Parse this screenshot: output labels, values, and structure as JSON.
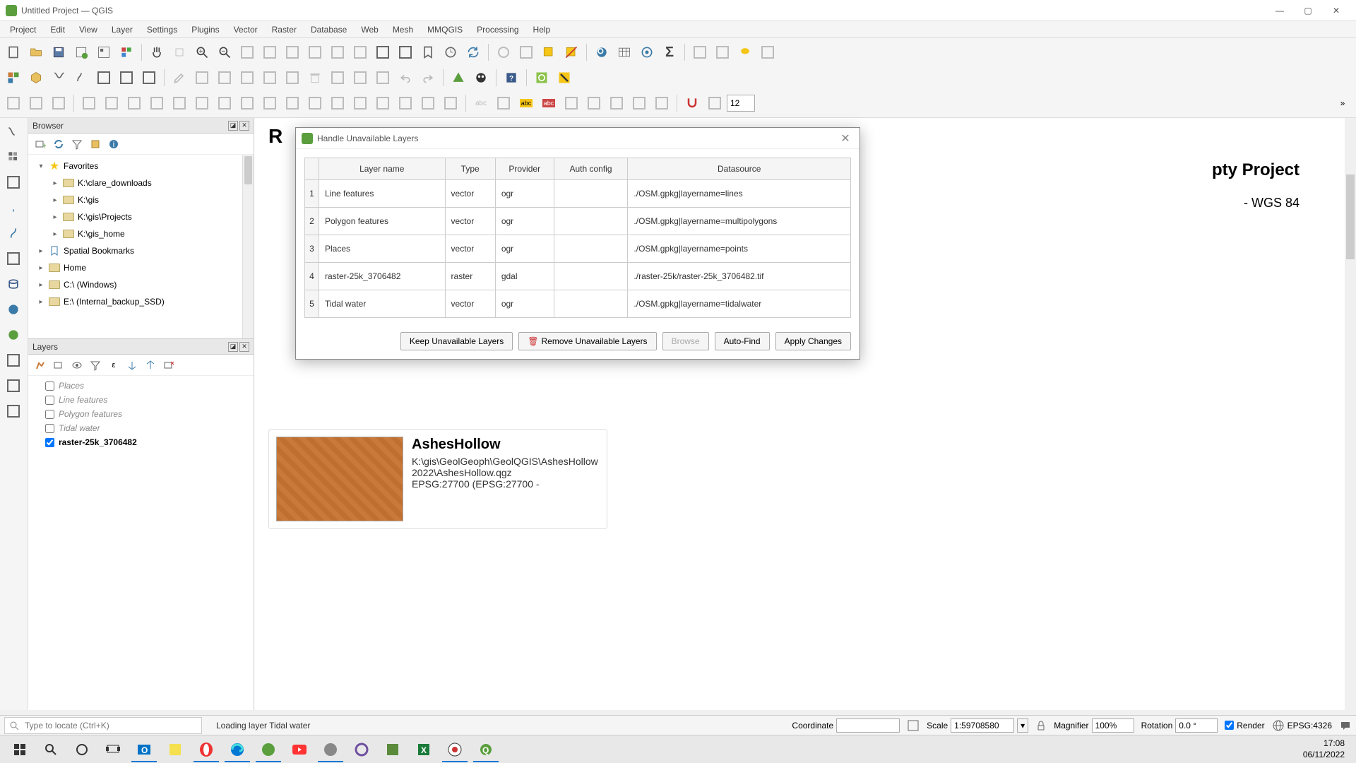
{
  "window": {
    "title": "Untitled Project — QGIS"
  },
  "menu": [
    "Project",
    "Edit",
    "View",
    "Layer",
    "Settings",
    "Plugins",
    "Vector",
    "Raster",
    "Database",
    "Web",
    "Mesh",
    "MMQGIS",
    "Processing",
    "Help"
  ],
  "browser": {
    "title": "Browser",
    "items": [
      {
        "label": "Favorites",
        "icon": "star",
        "depth": 0,
        "expanded": true
      },
      {
        "label": "K:\\clare_downloads",
        "icon": "folder",
        "depth": 1
      },
      {
        "label": "K:\\gis",
        "icon": "folder",
        "depth": 1
      },
      {
        "label": "K:\\gis\\Projects",
        "icon": "folder",
        "depth": 1
      },
      {
        "label": "K:\\gis_home",
        "icon": "folder",
        "depth": 1
      },
      {
        "label": "Spatial Bookmarks",
        "icon": "bookmark",
        "depth": 0
      },
      {
        "label": "Home",
        "icon": "folder",
        "depth": 0
      },
      {
        "label": "C:\\ (Windows)",
        "icon": "folder",
        "depth": 0
      },
      {
        "label": "E:\\ (Internal_backup_SSD)",
        "icon": "folder",
        "depth": 0
      }
    ]
  },
  "layers": {
    "title": "Layers",
    "items": [
      {
        "name": "Places",
        "checked": false,
        "broken": true
      },
      {
        "name": "Line features",
        "checked": false,
        "broken": true
      },
      {
        "name": "Polygon features",
        "checked": false,
        "broken": true
      },
      {
        "name": "Tidal water",
        "checked": false,
        "broken": true
      },
      {
        "name": "raster-25k_3706482",
        "checked": true,
        "broken": false
      }
    ]
  },
  "canvas": {
    "recent_heading": "R",
    "news_heading": "pty Project",
    "news_crs": "- WGS 84",
    "project": {
      "title": "AshesHollow",
      "path": "K:\\gis\\GeolGeoph\\GeolQGIS\\AshesHollow2022\\AshesHollow.qgz",
      "crs": "EPSG:27700 (EPSG:27700 -"
    }
  },
  "dialog": {
    "title": "Handle Unavailable Layers",
    "columns": [
      "Layer name",
      "Type",
      "Provider",
      "Auth config",
      "Datasource"
    ],
    "rows": [
      {
        "n": "1",
        "name": "Line features",
        "type": "vector",
        "provider": "ogr",
        "auth": "",
        "ds": "./OSM.gpkg|layername=lines"
      },
      {
        "n": "2",
        "name": "Polygon features",
        "type": "vector",
        "provider": "ogr",
        "auth": "",
        "ds": "./OSM.gpkg|layername=multipolygons"
      },
      {
        "n": "3",
        "name": "Places",
        "type": "vector",
        "provider": "ogr",
        "auth": "",
        "ds": "./OSM.gpkg|layername=points"
      },
      {
        "n": "4",
        "name": "raster-25k_3706482",
        "type": "raster",
        "provider": "gdal",
        "auth": "",
        "ds": "./raster-25k/raster-25k_3706482.tif"
      },
      {
        "n": "5",
        "name": "Tidal water",
        "type": "vector",
        "provider": "ogr",
        "auth": "",
        "ds": "./OSM.gpkg|layername=tidalwater"
      }
    ],
    "buttons": {
      "keep": "Keep Unavailable Layers",
      "remove": "Remove Unavailable Layers",
      "browse": "Browse",
      "autofind": "Auto-Find",
      "apply": "Apply Changes"
    }
  },
  "status": {
    "locator_placeholder": "Type to locate (Ctrl+K)",
    "message": "Loading layer Tidal water",
    "coord_label": "Coordinate",
    "coord_value": "",
    "scale_label": "Scale",
    "scale_value": "1:59708580",
    "mag_label": "Magnifier",
    "mag_value": "100%",
    "rot_label": "Rotation",
    "rot_value": "0.0 °",
    "render_label": "Render",
    "crs": "EPSG:4326"
  },
  "toolbar3": {
    "spin_value": "12"
  },
  "taskbar": {
    "time": "17:08",
    "date": "06/11/2022"
  }
}
